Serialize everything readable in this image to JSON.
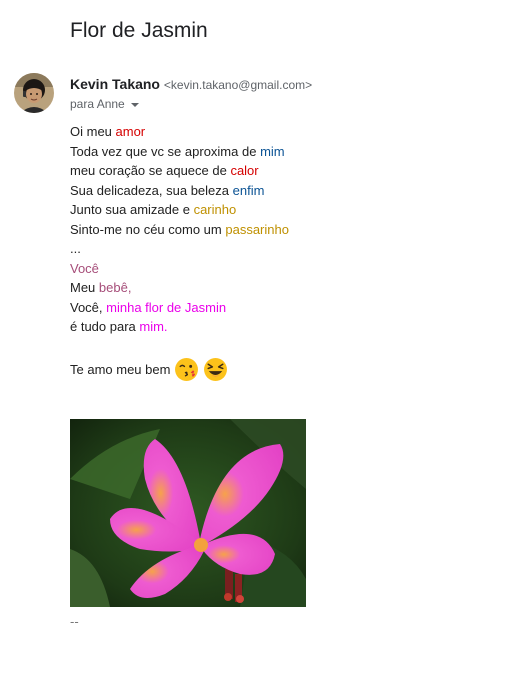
{
  "subject": "Flor de Jasmin",
  "sender": {
    "name": "Kevin Takano",
    "email": "<kevin.takano@gmail.com>",
    "to": "para Anne"
  },
  "message": {
    "l1": [
      "Oi meu ",
      "amor"
    ],
    "l2": [
      "Toda vez que vc se aproxima de ",
      "mim"
    ],
    "l3": [
      "meu coração se aquece de ",
      "calor"
    ],
    "l4": [
      "Sua delicadeza, sua beleza ",
      "enfim"
    ],
    "l5": [
      "Junto sua amizade e ",
      "carinho"
    ],
    "l6": [
      "Sinto-me no céu como um ",
      "passarinho"
    ],
    "l7": "...",
    "l8": "Você",
    "l9": [
      "Meu ",
      "bebê,"
    ],
    "l10": [
      "Você, ",
      "minha flor de Jasmin"
    ],
    "l11": [
      "é tudo para ",
      "mim."
    ],
    "love": "Te amo meu bem",
    "signature": "--"
  },
  "icons": {
    "emoji1": "kiss-face-icon",
    "emoji2": "laughing-face-icon",
    "image": "plumeria-flower-photo"
  },
  "colors": {
    "red": "#d50000",
    "blue": "#0b5394",
    "gold": "#bf9000",
    "purple": "#a64d79",
    "magenta": "#ea00ea"
  }
}
